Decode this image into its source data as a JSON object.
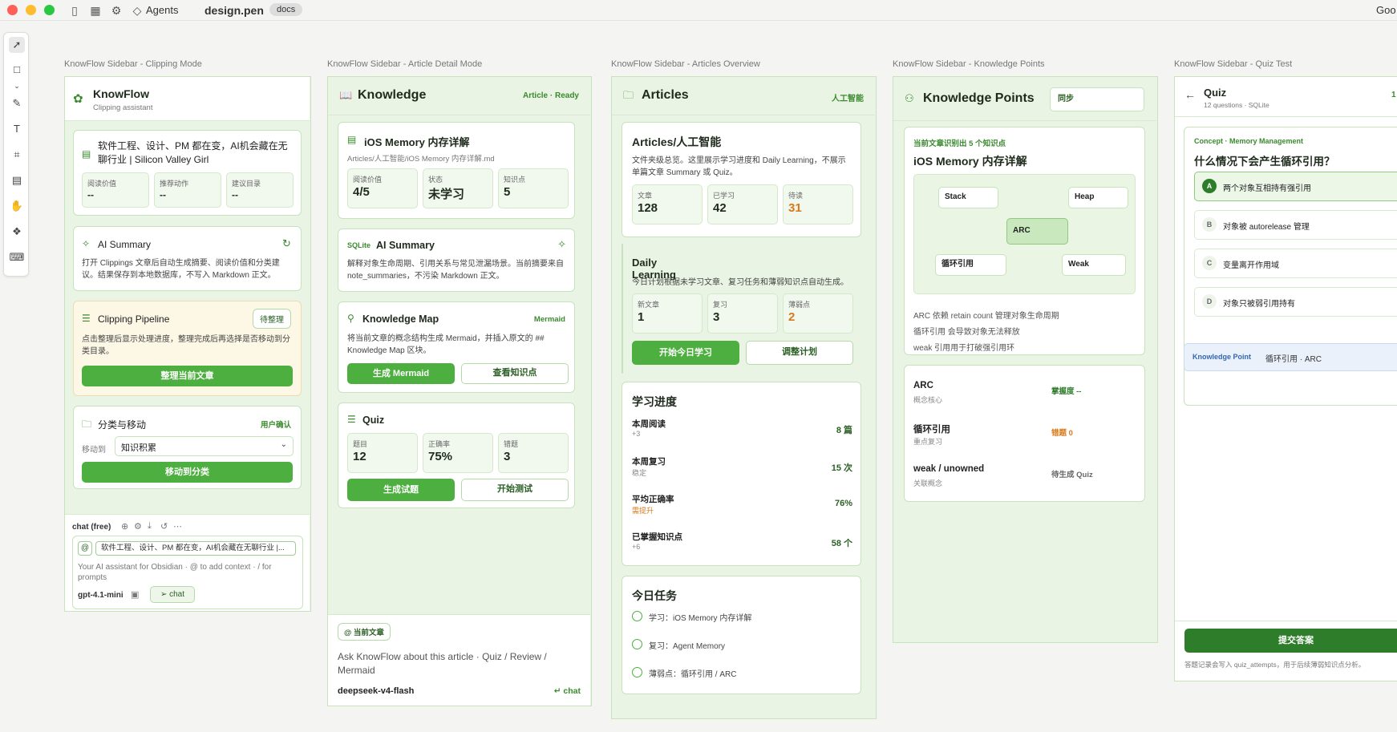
{
  "window": {
    "file_name": "design.pen",
    "tag": "docs",
    "agents_label": "Agents",
    "right_text": "Goo"
  },
  "frames": {
    "clipping": "KnowFlow Sidebar - Clipping Mode",
    "article": "KnowFlow Sidebar - Article Detail Mode",
    "articles": "KnowFlow Sidebar - Articles Overview",
    "kp": "KnowFlow Sidebar - Knowledge Points",
    "quiz": "KnowFlow Sidebar - Quiz Test"
  },
  "clipping": {
    "title": "KnowFlow",
    "subtitle": "Clipping assistant",
    "doc_title": "软件工程、设计、PM 都在变，AI机会藏在无聊行业 | Silicon Valley Girl",
    "stats": [
      {
        "label": "阅读价值",
        "value": "--"
      },
      {
        "label": "推荐动作",
        "value": "--"
      },
      {
        "label": "建议目录",
        "value": "--"
      }
    ],
    "ai_title": "AI Summary",
    "ai_text": "打开 Clippings 文章后自动生成摘要、阅读价值和分类建议。结果保存到本地数据库，不写入 Markdown 正文。",
    "pipe_title": "Clipping Pipeline",
    "pipe_badge": "待整理",
    "pipe_text": "点击整理后显示处理进度，整理完成后再选择是否移动到分类目录。",
    "pipe_button": "整理当前文章",
    "move_title": "分类与移动",
    "move_badge": "用户确认",
    "move_label": "移动到",
    "move_value": "知识积累",
    "move_button": "移动到分类",
    "chat_label": "chat (free)",
    "chat_chip": "软件工程、设计、PM 都在变，AI机会藏在无聊行业 |...",
    "chat_placeholder": "Your AI assistant for Obsidian · @ to add context · / for prompts",
    "model": "gpt-4.1-mini",
    "chat_button": "chat"
  },
  "article": {
    "title": "Knowledge",
    "status": "Article · Ready",
    "doc_title": "iOS Memory 内存详解",
    "path": "Articles/人工智能/iOS Memory 内存详解.md",
    "stats": [
      {
        "label": "阅读价值",
        "value": "4/5"
      },
      {
        "label": "状态",
        "value": "未学习"
      },
      {
        "label": "知识点",
        "value": "5"
      }
    ],
    "ai_prefix": "SQLite",
    "ai_title": "AI Summary",
    "ai_text": "解释对象生命周期、引用关系与常见泄漏场景。当前摘要来自 note_summaries，不污染 Markdown 正文。",
    "map_title": "Knowledge Map",
    "map_badge": "Mermaid",
    "map_text": "将当前文章的概念结构生成 Mermaid，并插入原文的 ## Knowledge Map 区块。",
    "map_btn1": "生成 Mermaid",
    "map_btn2": "查看知识点",
    "quiz_title": "Quiz",
    "quiz_stats": [
      {
        "label": "题目",
        "value": "12"
      },
      {
        "label": "正确率",
        "value": "75%"
      },
      {
        "label": "错题",
        "value": "3"
      }
    ],
    "quiz_btn1": "生成试题",
    "quiz_btn2": "开始测试",
    "chip": "当前文章",
    "prompt": "Ask KnowFlow about this article · Quiz / Review / Mermaid",
    "model": "deepseek-v4-flash",
    "send": "chat"
  },
  "articles": {
    "title": "Articles",
    "tag": "人工智能",
    "folder_title": "Articles/人工智能",
    "folder_text": "文件夹级总览。这里展示学习进度和 Daily Learning，不展示单篇文章 Summary 或 Quiz。",
    "stats": [
      {
        "label": "文章",
        "value": "128"
      },
      {
        "label": "已学习",
        "value": "42"
      },
      {
        "label": "待读",
        "value": "31"
      }
    ],
    "daily_title": "Daily Learning",
    "daily_text": "今日计划根据未学习文章、复习任务和薄弱知识点自动生成。",
    "daily_stats": [
      {
        "label": "新文章",
        "value": "1"
      },
      {
        "label": "复习",
        "value": "3"
      },
      {
        "label": "薄弱点",
        "value": "2"
      }
    ],
    "daily_btn1": "开始今日学习",
    "daily_btn2": "调整计划",
    "progress_title": "学习进度",
    "progress": [
      {
        "label": "本周阅读",
        "sub": "+3",
        "value": "8 篇"
      },
      {
        "label": "本周复习",
        "sub": "稳定",
        "value": "15 次"
      },
      {
        "label": "平均正确率",
        "sub": "需提升",
        "value": "76%"
      },
      {
        "label": "已掌握知识点",
        "sub": "+6",
        "value": "58 个"
      }
    ],
    "tasks_title": "今日任务",
    "tasks": [
      "学习：iOS Memory 内存详解",
      "复习：Agent Memory",
      "薄弱点：循环引用 / ARC"
    ]
  },
  "kp": {
    "title": "Knowledge Points",
    "sync": "同步",
    "found": "当前文章识别出 5 个知识点",
    "doc_title": "iOS Memory 内存详解",
    "nodes": [
      "Stack",
      "Heap",
      "ARC",
      "循环引用",
      "Weak"
    ],
    "notes": [
      "ARC 依赖 retain count 管理对象生命周期",
      "循环引用 会导致对象无法释放",
      "weak 引用用于打破强引用环"
    ],
    "points": [
      {
        "name": "ARC",
        "sub": "概念核心",
        "status": "掌握度 --"
      },
      {
        "name": "循环引用",
        "sub": "重点复习",
        "status": "错题 0"
      },
      {
        "name": "weak / unowned",
        "sub": "关联概念",
        "status": "待生成 Quiz"
      }
    ]
  },
  "quiz": {
    "title": "Quiz",
    "subtitle": "12 questions · SQLite",
    "counter": "1",
    "concept": "Concept · Memory Management",
    "question": "什么情况下会产生循环引用？",
    "options": [
      {
        "key": "A",
        "text": "两个对象互相持有强引用"
      },
      {
        "key": "B",
        "text": "对象被 autorelease 管理"
      },
      {
        "key": "C",
        "text": "变量离开作用域"
      },
      {
        "key": "D",
        "text": "对象只被弱引用持有"
      }
    ],
    "kp_label": "Knowledge Point",
    "kp_value": "循环引用 · ARC",
    "submit": "提交答案",
    "footer": "答题记录会写入 quiz_attempts，用于后续薄弱知识点分析。"
  }
}
